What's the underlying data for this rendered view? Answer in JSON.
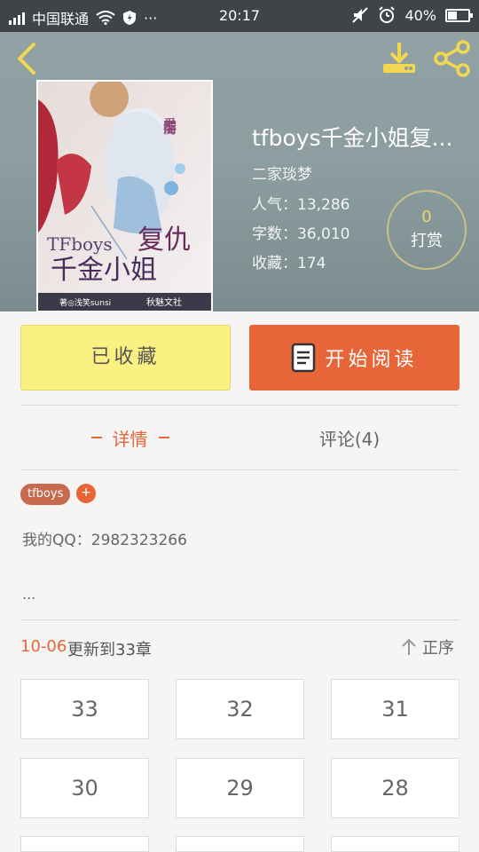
{
  "status_bar": {
    "carrier": "中国联通",
    "time": "20:17",
    "battery": "40%"
  },
  "header": {
    "book_title": "tfboys千金小姐复...",
    "author": "二家琰梦",
    "popularity": "人气：13,286",
    "word_count": "字数：36,010",
    "favorites": "收藏：174",
    "reward_count": "0",
    "reward_label": "打赏",
    "cover": {
      "love_text": "爱上你，不后悔",
      "brand_text": "TFboys",
      "title_text": "千金小姐",
      "revenge_text": "复仇",
      "author_text": "著◎浅笑sunsi",
      "publisher_text": "秋魅文社"
    }
  },
  "actions": {
    "collected_label": "已收藏",
    "read_label": "开始阅读"
  },
  "tabs": {
    "details_label": "详情",
    "comments_label": "评论(4)"
  },
  "details": {
    "tag": "tfboys",
    "add_tag": "+",
    "description": "我的QQ：2982323266",
    "more": "..."
  },
  "updates": {
    "date": "10-06",
    "text": "更新到33章",
    "sort_label": "正序"
  },
  "chapters": [
    "33",
    "32",
    "31",
    "30",
    "29",
    "28",
    "",
    "",
    ""
  ],
  "colors": {
    "accent": "#e8653a",
    "collected_bg": "#fbf082",
    "header_bg": "#8d9ea0"
  }
}
